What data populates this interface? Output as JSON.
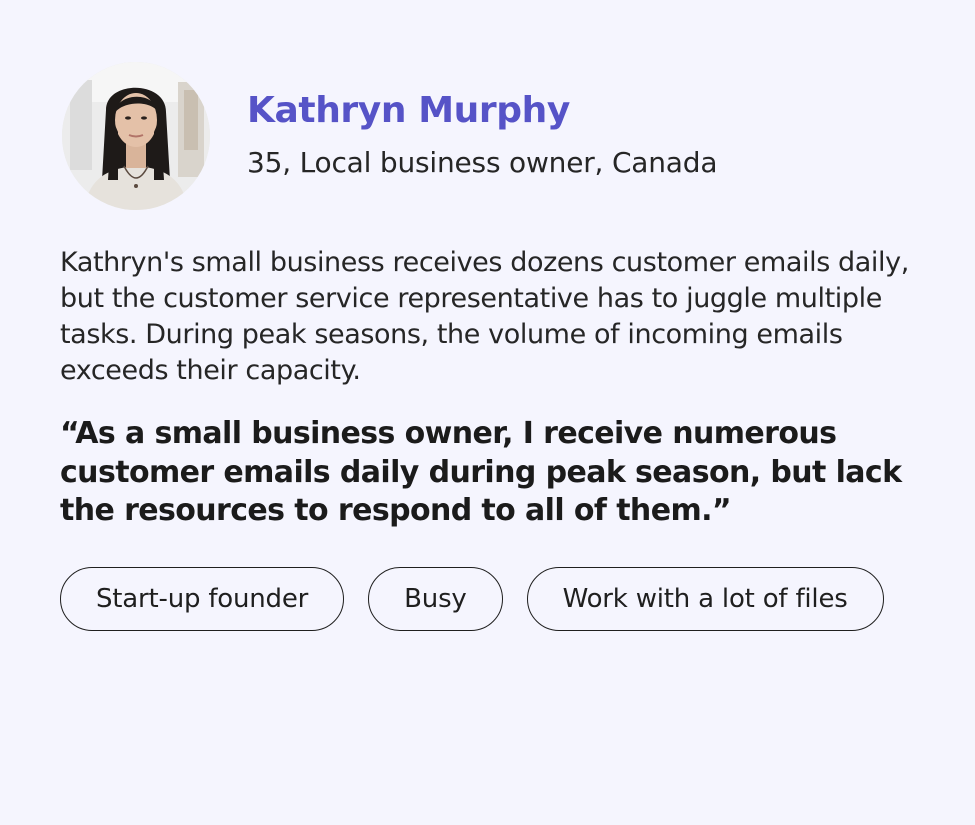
{
  "profile": {
    "name": "Kathryn Murphy",
    "subtitle": "35, Local business owner, Canada",
    "avatar_alt": "portrait of Kathryn Murphy"
  },
  "description": "Kathryn's small business receives dozens customer emails daily, but the customer service representative has to juggle multiple tasks. During peak seasons, the volume of incoming emails exceeds their capacity.",
  "quote": "“As a small business owner, I receive numerous customer emails daily during peak season, but lack the resources to respond to all of them.”",
  "tags": [
    "Start-up founder",
    "Busy",
    "Work with a lot of files"
  ],
  "colors": {
    "background": "#f5f5fe",
    "name_accent": "#5653c7",
    "text": "#262626",
    "tag_border": "#1f1f1f"
  }
}
